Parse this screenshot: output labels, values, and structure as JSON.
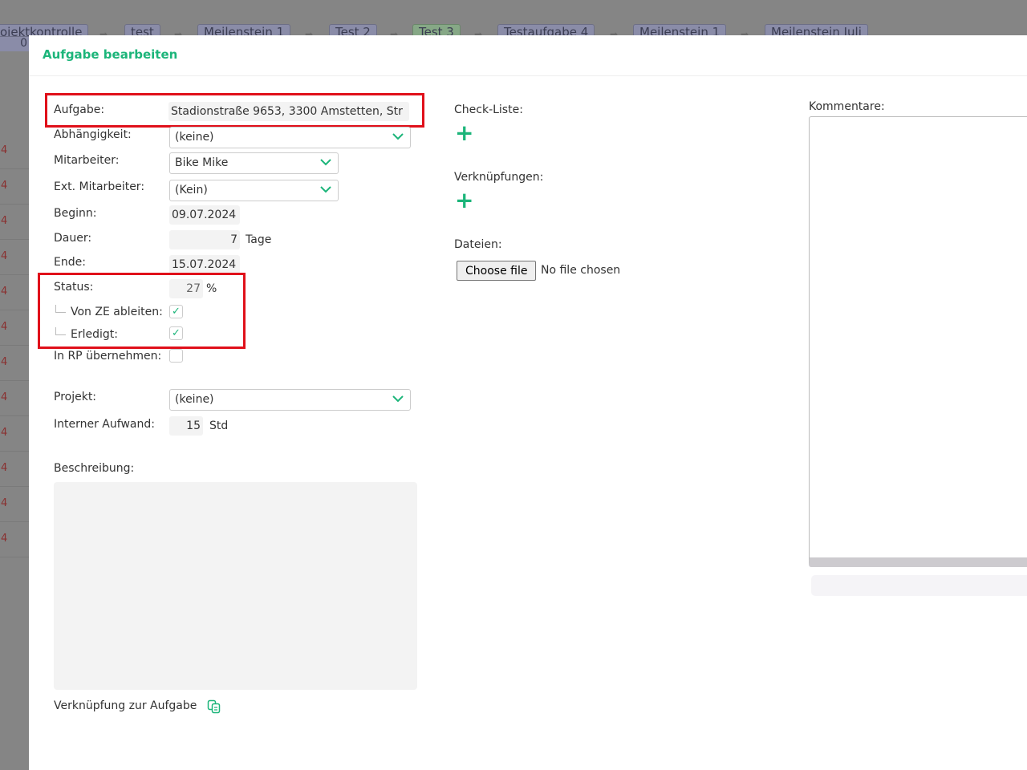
{
  "breadcrumbs": [
    "ojektkontrolle",
    "test",
    "Meilenstein 1",
    "Test 2",
    "Test 3",
    "Testaufgabe 4",
    "Meilenstein 1",
    "Meilenstein Juli"
  ],
  "breadcrumb_sub": "0",
  "left_values": [
    "4",
    "4",
    "4",
    "4",
    "4",
    "4",
    "4",
    "4",
    "4",
    "4",
    "4",
    "4"
  ],
  "modal": {
    "title": "Aufgabe bearbeiten",
    "aufgabe": {
      "label": "Aufgabe:",
      "value": "Stadionstraße 9653, 3300 Amstetten, Str"
    },
    "abhaengigkeit": {
      "label": "Abhängigkeit:",
      "value": "(keine)"
    },
    "mitarbeiter": {
      "label": "Mitarbeiter:",
      "value": "Bike Mike"
    },
    "ext_mitarbeiter": {
      "label": "Ext. Mitarbeiter:",
      "value": "(Kein)"
    },
    "beginn": {
      "label": "Beginn:",
      "value": "09.07.2024"
    },
    "dauer": {
      "label": "Dauer:",
      "value": "7",
      "unit": "Tage"
    },
    "ende": {
      "label": "Ende:",
      "value": "15.07.2024"
    },
    "status": {
      "label": "Status:",
      "value": "27",
      "unit": "%"
    },
    "von_ze": {
      "label": "Von ZE ableiten:",
      "checked": true
    },
    "erledigt": {
      "label": "Erledigt:",
      "checked": true
    },
    "in_rp": {
      "label": "In RP übernehmen:",
      "checked": false
    },
    "projekt": {
      "label": "Projekt:",
      "value": "(keine)"
    },
    "aufwand": {
      "label": "Interner Aufwand:",
      "value": "15",
      "unit": "Std"
    },
    "beschreibung": {
      "label": "Beschreibung:"
    },
    "link": {
      "label": "Verknüpfung zur Aufgabe",
      "icon": "copy-icon"
    },
    "checkliste": {
      "label": "Check-Liste:"
    },
    "verknuepfungen": {
      "label": "Verknüpfungen:"
    },
    "dateien": {
      "label": "Dateien:",
      "button": "Choose file",
      "status": "No file chosen"
    },
    "kommentare": {
      "label": "Kommentare:"
    },
    "accent": "#1cb57a",
    "highlight": "#e0101a"
  }
}
